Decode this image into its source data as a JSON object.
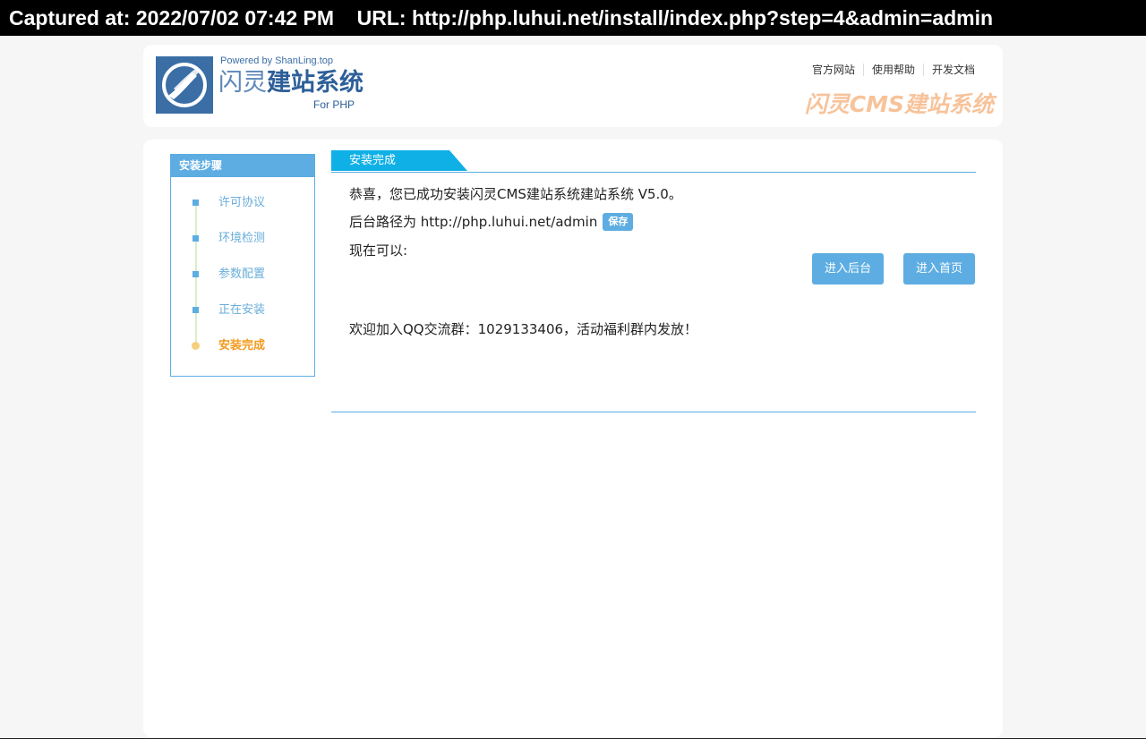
{
  "capture": {
    "text": "Captured at: 2022/07/02 07:42 PM    URL: http://php.luhui.net/install/index.php?step=4&admin=admin"
  },
  "header": {
    "logo_powered": "Powered by ShanLing.top",
    "logo_name_thin": "闪灵",
    "logo_name_bold": "建站系统",
    "logo_for": "For PHP",
    "links": [
      "官方网站",
      "使用帮助",
      "开发文档"
    ],
    "tagline": "闪灵CMS建站系统"
  },
  "steps": {
    "title": "安装步骤",
    "items": [
      "许可协议",
      "环境检测",
      "参数配置",
      "正在安装",
      "安装完成"
    ],
    "current_index": 4
  },
  "content": {
    "tab_label": "安装完成",
    "congrats": "恭喜，您已成功安装闪灵CMS建站系统建站系统 V5.0。",
    "admin_path": "后台路径为 http://php.luhui.net/admin",
    "save_label": "保存",
    "now_can": "现在可以:",
    "btn_admin": "进入后台",
    "btn_home": "进入首页",
    "qq_group": "欢迎加入QQ交流群：1029133406，活动福利群内发放！"
  },
  "colors": {
    "accent": "#5dade2",
    "current_step": "#f39a1e",
    "tagline": "#f7c39a",
    "logo_blue": "#2d5f98"
  }
}
